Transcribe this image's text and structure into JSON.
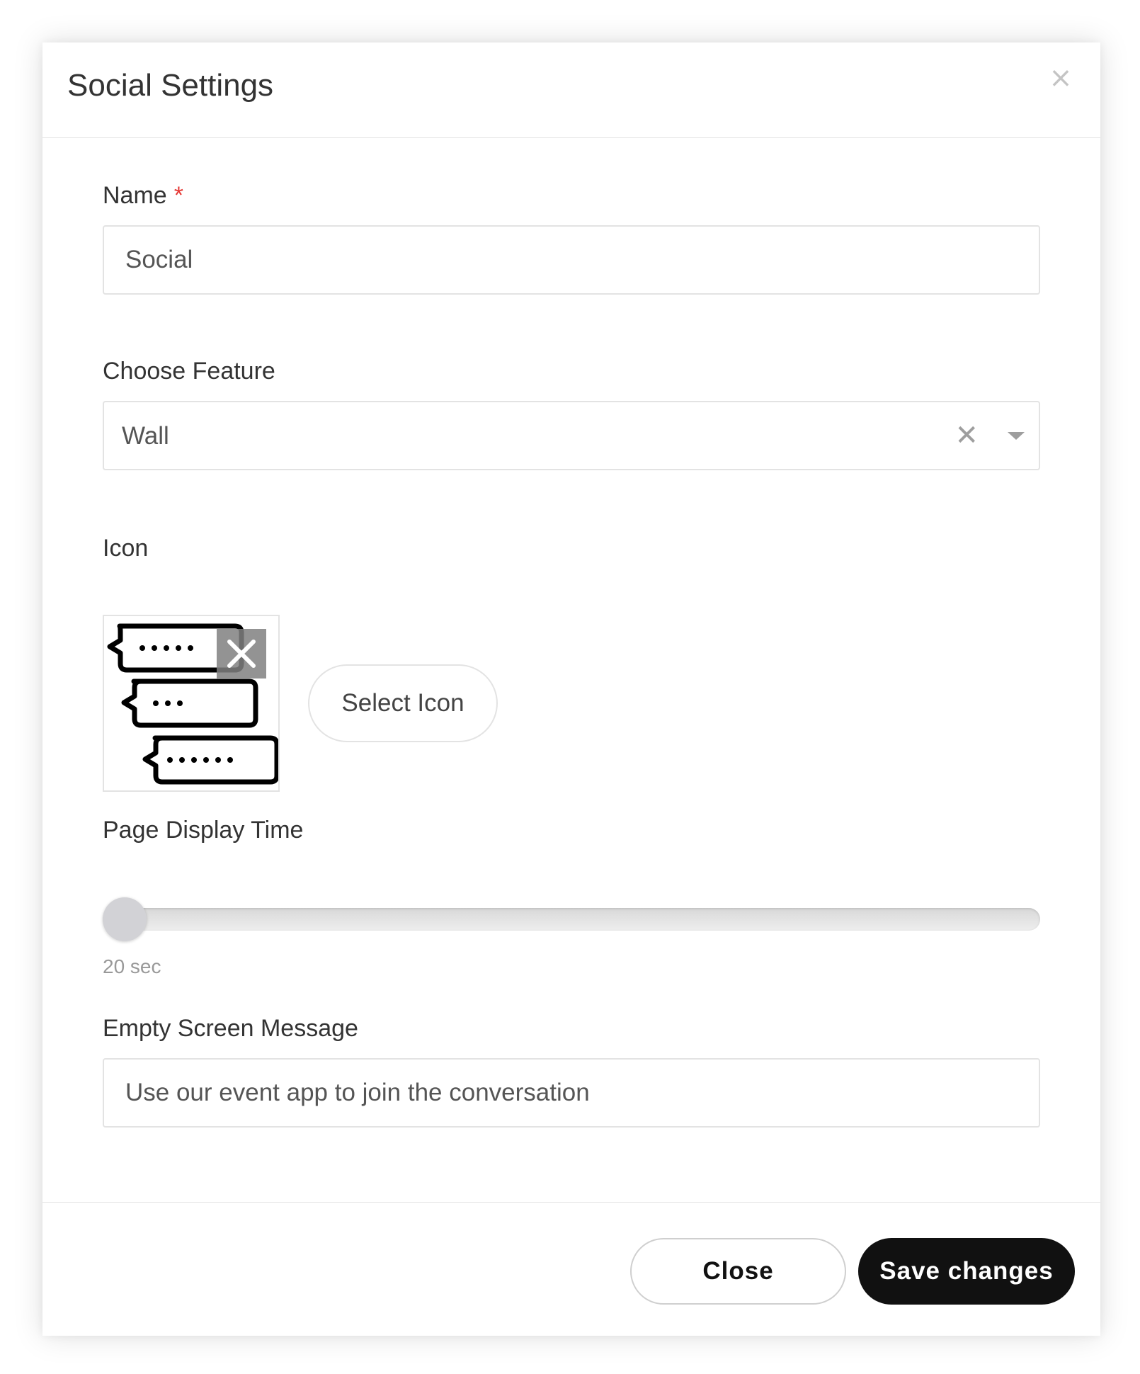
{
  "modal": {
    "title": "Social Settings",
    "close_icon": "close-icon"
  },
  "form": {
    "name": {
      "label": "Name",
      "required_mark": "*",
      "value": "Social"
    },
    "feature": {
      "label": "Choose Feature",
      "selected": "Wall",
      "clear_glyph": "✕"
    },
    "icon": {
      "label": "Icon",
      "preview_icon": "chat-bubbles-icon",
      "remove_glyph": "remove-icon",
      "select_button_label": "Select Icon"
    },
    "display_time": {
      "label": "Page Display Time",
      "value_text": "20 sec",
      "slider_fraction": 0.0
    },
    "empty_message": {
      "label": "Empty Screen Message",
      "value": "Use our event app to join the conversation"
    }
  },
  "footer": {
    "close_label": "Close",
    "save_label": "Save changes"
  },
  "colors": {
    "required": "#e53935",
    "primary_button": "#111111"
  }
}
